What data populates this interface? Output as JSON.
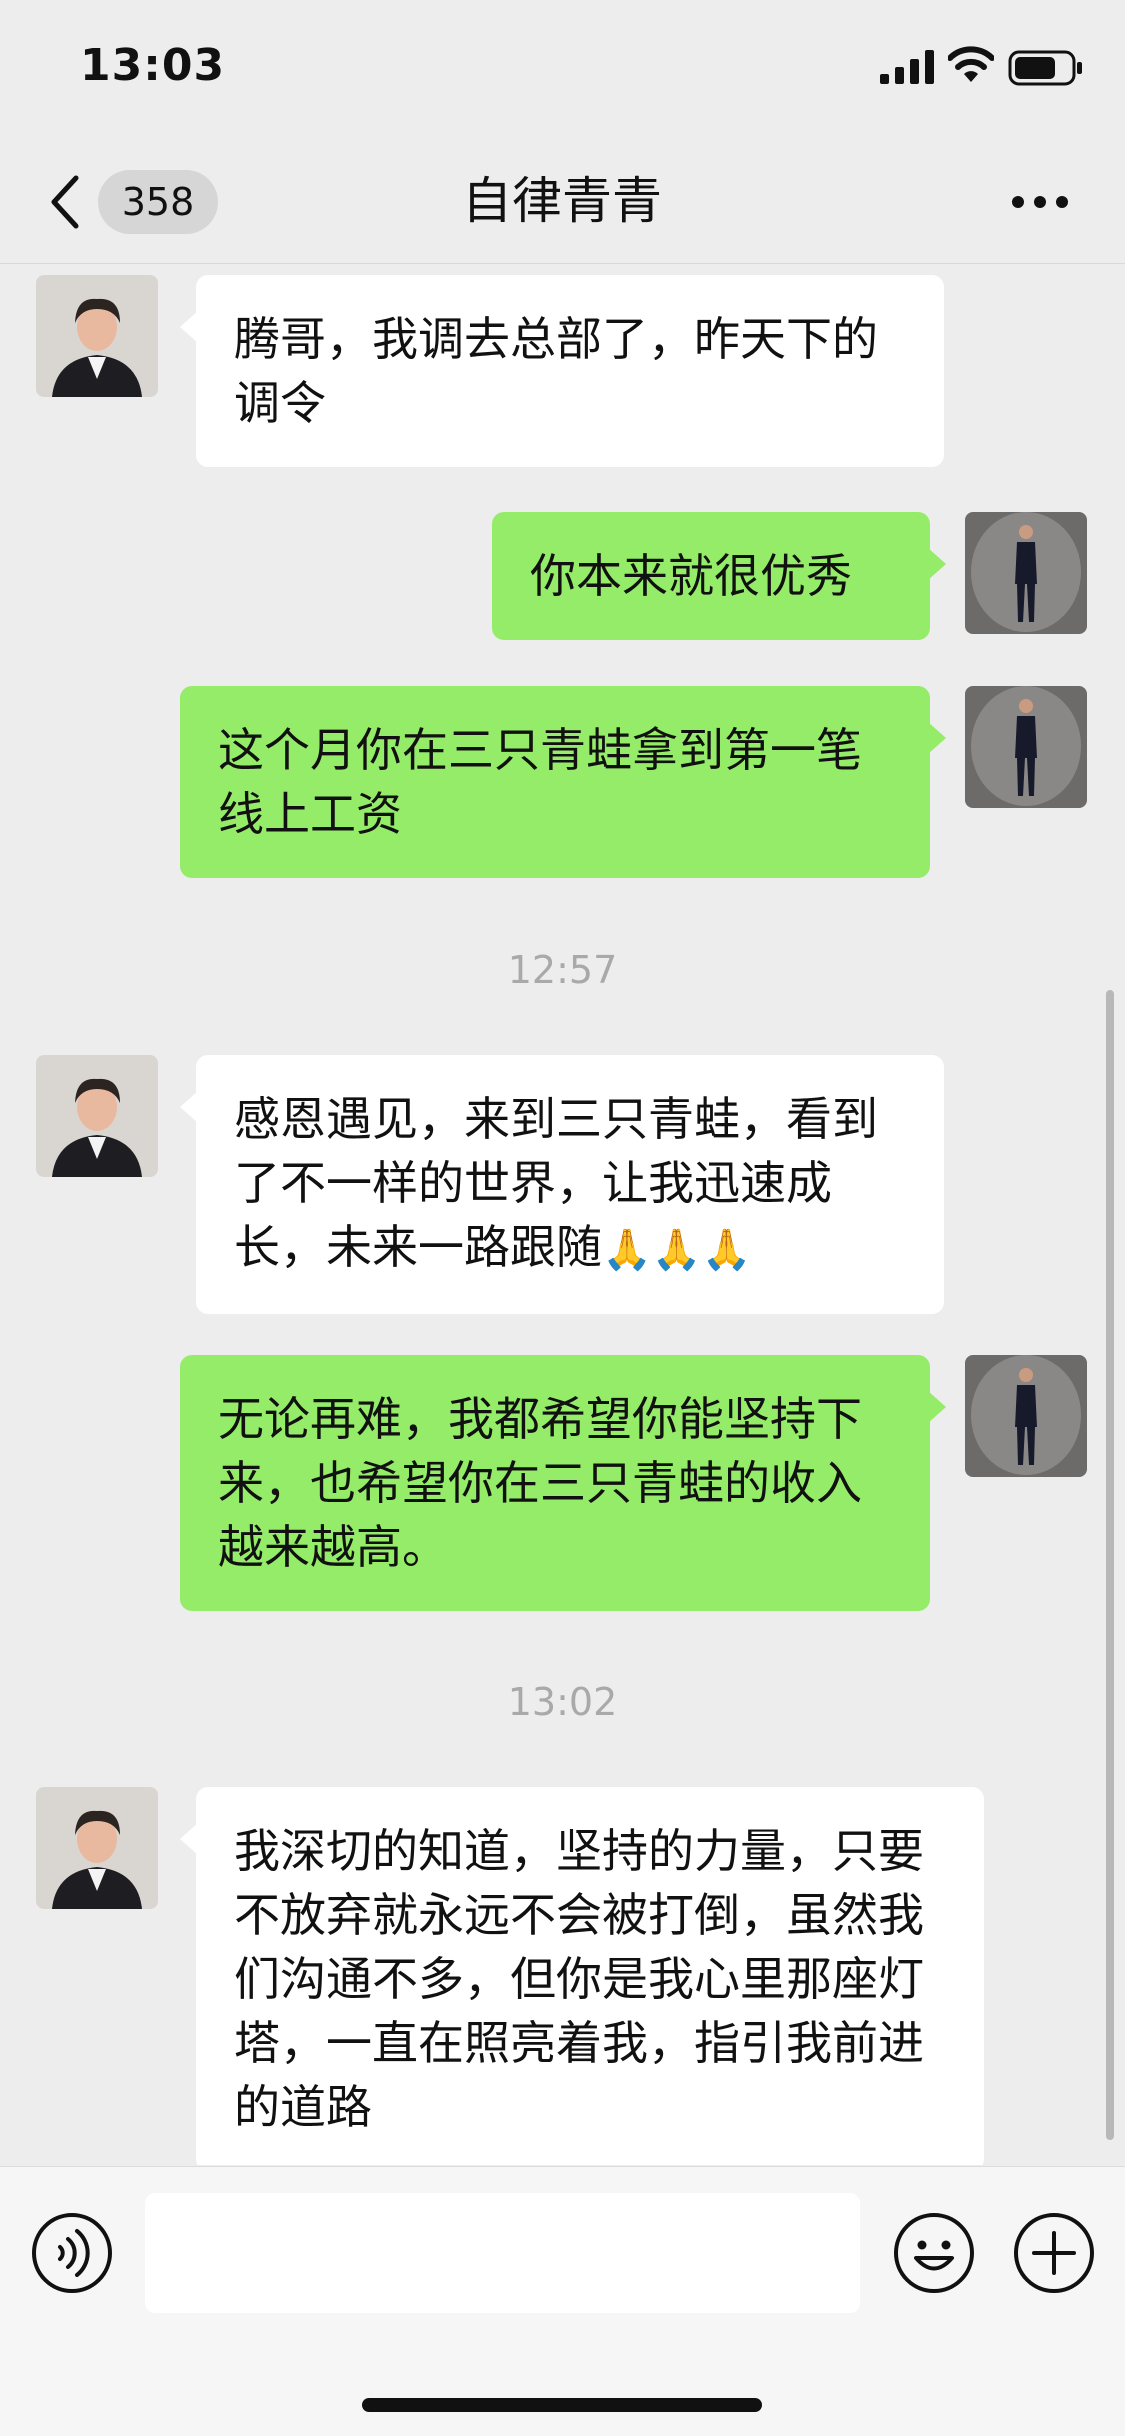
{
  "status_bar": {
    "time": "13:03"
  },
  "header": {
    "unread_count": "358",
    "title": "自律青青"
  },
  "messages": [
    {
      "side": "left",
      "text": "腾哥，我调去总部了，昨天下的调令"
    },
    {
      "side": "right",
      "text": "你本来就很优秀"
    },
    {
      "side": "right",
      "text": "这个月你在三只青蛙拿到第一笔线上工资"
    },
    {
      "type": "time",
      "text": "12:57"
    },
    {
      "side": "left",
      "text": "感恩遇见，来到三只青蛙，看到了不一样的世界，让我迅速成长，未来一路跟随",
      "emoji": "🙏🙏🙏"
    },
    {
      "side": "right",
      "text": "无论再难，我都希望你能坚持下来，也希望你在三只青蛙的收入越来越高。"
    },
    {
      "type": "time",
      "text": "13:02"
    },
    {
      "side": "left",
      "text": "我深切的知道，坚持的力量，只要不放弃就永远不会被打倒，虽然我们沟通不多，但你是我心里那座灯塔，一直在照亮着我，指引我前进的道路"
    }
  ],
  "input": {
    "placeholder": ""
  },
  "icons": {
    "back": "chevron-left-icon",
    "more": "more-dots-icon",
    "voice": "voice-icon",
    "emoji": "smiley-icon",
    "plus": "plus-icon"
  },
  "colors": {
    "sent_bubble": "#95ec69",
    "received_bubble": "#ffffff",
    "background": "#ededed"
  }
}
